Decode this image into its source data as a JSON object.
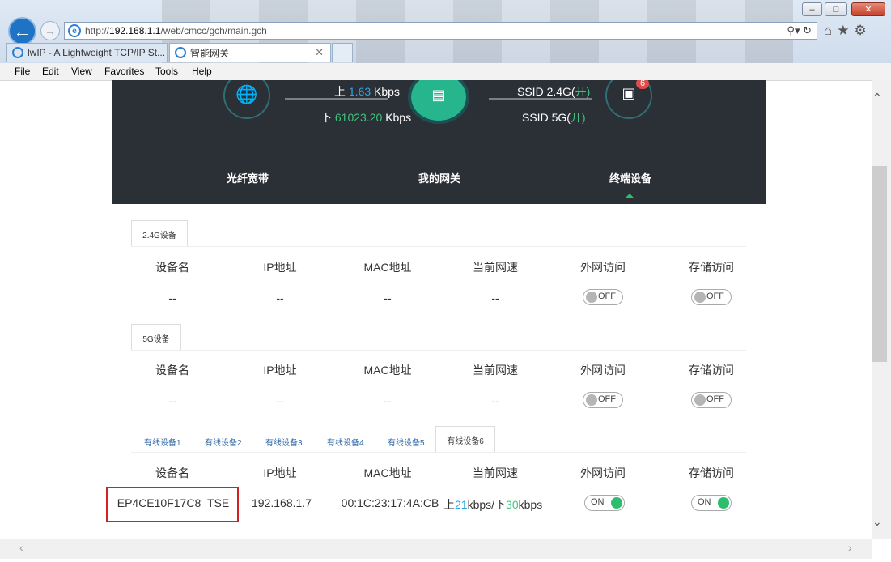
{
  "browser": {
    "url_prefix": "http://",
    "url_host": "192.168.1.1",
    "url_path": "/web/cmcc/gch/main.gch",
    "tabs": [
      {
        "label": "lwIP - A Lightweight TCP/IP St..."
      },
      {
        "label": "智能网关"
      }
    ],
    "menu": [
      "File",
      "Edit",
      "View",
      "Favorites",
      "Tools",
      "Help"
    ],
    "window_buttons": {
      "minimize": "–",
      "maximize": "□",
      "close": "✕"
    }
  },
  "banner": {
    "up_prefix": "上",
    "up_value": "1.63",
    "up_unit": "Kbps",
    "down_prefix": "下",
    "down_value": "61023.20",
    "down_unit": "Kbps",
    "ssid24_label": "SSID 2.4G(",
    "ssid24_state": "开",
    "ssid5_label": "SSID 5G(",
    "ssid5_state": "开",
    "close_paren": ")",
    "device_badge": "6",
    "nav": [
      "光纤宽带",
      "我的网关",
      "终端设备"
    ]
  },
  "headers": [
    "设备名",
    "IP地址",
    "MAC地址",
    "当前网速",
    "外网访问",
    "存储访问"
  ],
  "section_24g": {
    "tab": "2.4G设备",
    "row": {
      "name": "--",
      "ip": "--",
      "mac": "--",
      "speed": "--",
      "wan": "OFF",
      "storage": "OFF"
    }
  },
  "section_5g": {
    "tab": "5G设备",
    "row": {
      "name": "--",
      "ip": "--",
      "mac": "--",
      "speed": "--",
      "wan": "OFF",
      "storage": "OFF"
    }
  },
  "section_wired": {
    "tabs": [
      "有线设备1",
      "有线设备2",
      "有线设备3",
      "有线设备4",
      "有线设备5",
      "有线设备6"
    ],
    "active_tab": "有线设备6",
    "row": {
      "name": "EP4CE10F17C8_TSE",
      "ip": "192.168.1.7",
      "mac": "00:1C:23:17:4A:CB",
      "speed_up_prefix": "上",
      "speed_up": "21",
      "speed_mid": "kbps/下",
      "speed_down": "30",
      "speed_unit": "kbps",
      "wan": "ON",
      "storage": "ON"
    }
  },
  "colors": {
    "accent_green": "#2dbd6e",
    "accent_blue": "#2aa6e8",
    "highlight_red": "#d32020"
  }
}
